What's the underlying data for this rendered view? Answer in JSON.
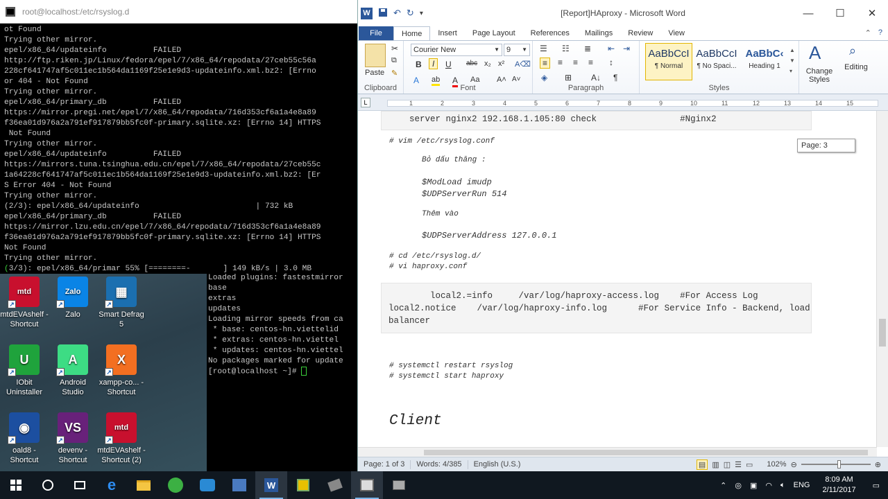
{
  "terminal": {
    "title": "root@localhost:/etc/rsyslog.d",
    "lines": [
      "ot Found",
      "Trying other mirror.",
      "epel/x86_64/updateinfo          FAILED",
      "http://ftp.riken.jp/Linux/fedora/epel/7/x86_64/repodata/27ceb55c56a",
      "228cf641747af5c011ec1b564da1169f25e1e9d3-updateinfo.xml.bz2: [Errno",
      "or 404 - Not Found",
      "Trying other mirror.",
      "epel/x86_64/primary_db          FAILED",
      "https://mirror.pregi.net/epel/7/x86_64/repodata/716d353cf6a1a4e8a89",
      "f36ea01d976a2a791ef917879bb5fc0f-primary.sqlite.xz: [Errno 14] HTTPS",
      " Not Found",
      "Trying other mirror.",
      "epel/x86_64/updateinfo          FAILED",
      "https://mirrors.tuna.tsinghua.edu.cn/epel/7/x86_64/repodata/27ceb55c",
      "1a64228cf641747af5c011ec1b564da1169f25e1e9d3-updateinfo.xml.bz2: [Er",
      "S Error 404 - Not Found",
      "Trying other mirror.",
      "(2/3): epel/x86_64/updateinfo                         | 732 kB",
      "epel/x86_64/primary_db          FAILED",
      "https://mirror.lzu.edu.cn/epel/7/x86_64/repodata/716d353cf6a1a4e8a89",
      "f36ea01d976a2a791ef917879bb5fc0f-primary.sqlite.xz: [Errno 14] HTTPS",
      "Not Found",
      "Trying other mirror."
    ],
    "progress_prefix": "(",
    "progress_main": "3/3): epel/x86_64/primar 55% [========-       ] 149 kB/s | 3.0 MB"
  },
  "terminal2": {
    "lines": [
      "Loaded plugins: fastestmirror",
      "base",
      "extras",
      "updates",
      "Loading mirror speeds from ca",
      " * base: centos-hn.viettelid",
      " * extras: centos-hn.viettel",
      " * updates: centos-hn.viettel",
      "No packages marked for update"
    ],
    "prompt": "[root@localhost ~]# "
  },
  "desktop": {
    "icons": [
      {
        "label": "mtdEVAshelf - Shortcut",
        "glyph": "mtd",
        "color": "#c8102e"
      },
      {
        "label": "Zalo",
        "glyph": "Zalo",
        "color": "#0a84e6"
      },
      {
        "label": "Smart Defrag 5",
        "glyph": "▦",
        "color": "#1b6fb0"
      },
      {
        "label": "IObit Uninstaller",
        "glyph": "U",
        "color": "#1fa33c"
      },
      {
        "label": "Android Studio",
        "glyph": "A",
        "color": "#3ddc84"
      },
      {
        "label": "xampp-co... - Shortcut",
        "glyph": "X",
        "color": "#f36f21"
      },
      {
        "label": "oald8 - Shortcut",
        "glyph": "◉",
        "color": "#1c4fa0"
      },
      {
        "label": "devenv - Shortcut",
        "glyph": "VS",
        "color": "#68217a"
      },
      {
        "label": "mtdEVAshelf - Shortcut (2)",
        "glyph": "mtd",
        "color": "#c8102e"
      }
    ]
  },
  "word": {
    "title": "[Report]HAproxy - Microsoft Word",
    "tabs": [
      "File",
      "Home",
      "Insert",
      "Page Layout",
      "References",
      "Mailings",
      "Review",
      "View"
    ],
    "ribbon": {
      "paste": "Paste",
      "clipboard": "Clipboard",
      "font_name": "Courier New",
      "font_size": "9",
      "font": "Font",
      "paragraph": "Paragraph",
      "styles": "Styles",
      "styles_list": [
        {
          "preview": "AaBbCcI",
          "name": "¶ Normal"
        },
        {
          "preview": "AaBbCcI",
          "name": "¶ No Spaci..."
        },
        {
          "preview": "AaBbC‹",
          "name": "Heading 1"
        }
      ],
      "change_styles": "Change Styles",
      "editing": "Editing"
    },
    "ruler_numbers": [
      "1",
      "2",
      "3",
      "4",
      "5",
      "6",
      "7",
      "8",
      "9",
      "10",
      "11",
      "12",
      "13",
      "14",
      "15"
    ],
    "page_tip": "Page: 3",
    "doc": {
      "box1": "server nginx2 192.168.1.105:80 check                #Nginx2",
      "cmd1": "# vim /etc/rsyslog.conf",
      "bo_dau": "Bỏ dấu thăng :",
      "modload": "$ModLoad imudp",
      "udpserver": "$UDPServerRun 514",
      "them_vao": "Thêm vào",
      "udpaddr": "$UDPServerAddress 127.0.0.1",
      "cmd2": "# cd /etc/rsyslog.d/",
      "cmd3": "# vi haproxy.conf",
      "box2_l1": "        local2.=info     /var/log/haproxy-access.log    #For Access Log",
      "box2_l2": "local2.notice    /var/log/haproxy-info.log      #For Service Info - Backend, load",
      "box2_l3": "balancer",
      "cmd4": "# systemctl restart rsyslog",
      "cmd5": "# systemctl start haproxy",
      "heading": "Client"
    },
    "status": {
      "page": "Page: 1 of 3",
      "words": "Words: 4/385",
      "lang": "English (U.S.)",
      "zoom": "102%"
    }
  },
  "taskbar": {
    "lang": "ENG",
    "time": "8:09 AM",
    "date": "2/11/2017"
  }
}
